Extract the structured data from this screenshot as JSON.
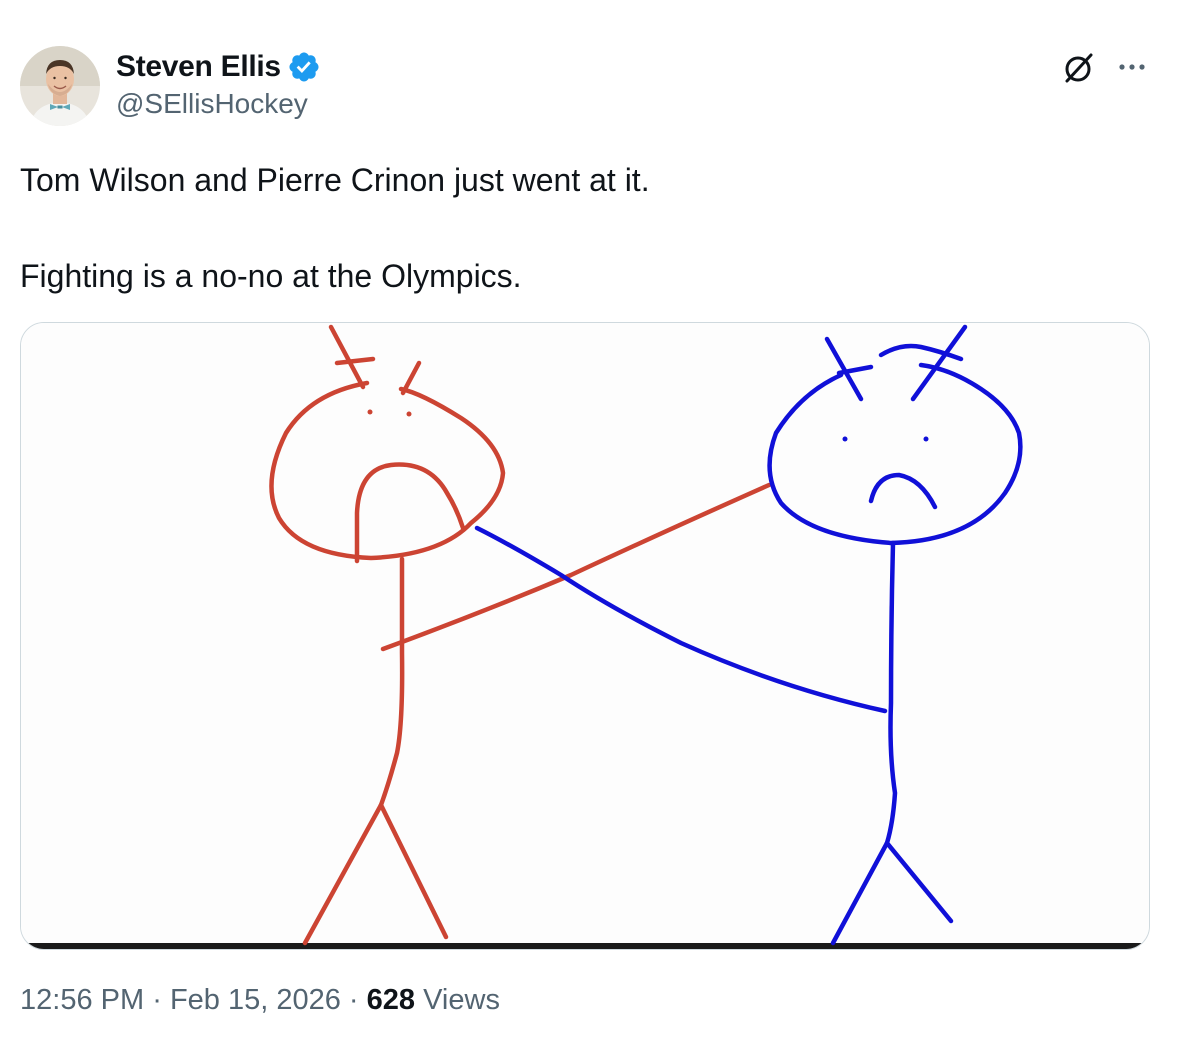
{
  "author": {
    "display_name": "Steven Ellis",
    "handle": "@SEllisHockey",
    "verified": true,
    "avatar_icon": "profile-photo"
  },
  "header_actions": {
    "grok_icon": "grok-icon",
    "more_icon": "more-icon"
  },
  "tweet": {
    "line1": "Tom Wilson and Pierre Crinon just went at it.",
    "line2": "Fighting is a no-no at the Olympics."
  },
  "media": {
    "description_icon": "stick-figure-drawing",
    "colors": {
      "left_figure": "#cc4433",
      "right_figure": "#1010d8"
    }
  },
  "meta": {
    "time": "12:56 PM",
    "separator": "·",
    "date": "Feb 15, 2026",
    "views_count": "628",
    "views_label": "Views"
  },
  "colors": {
    "text": "#0f1419",
    "secondary": "#536471",
    "verified": "#1d9bf0",
    "border": "#cfd9de"
  }
}
